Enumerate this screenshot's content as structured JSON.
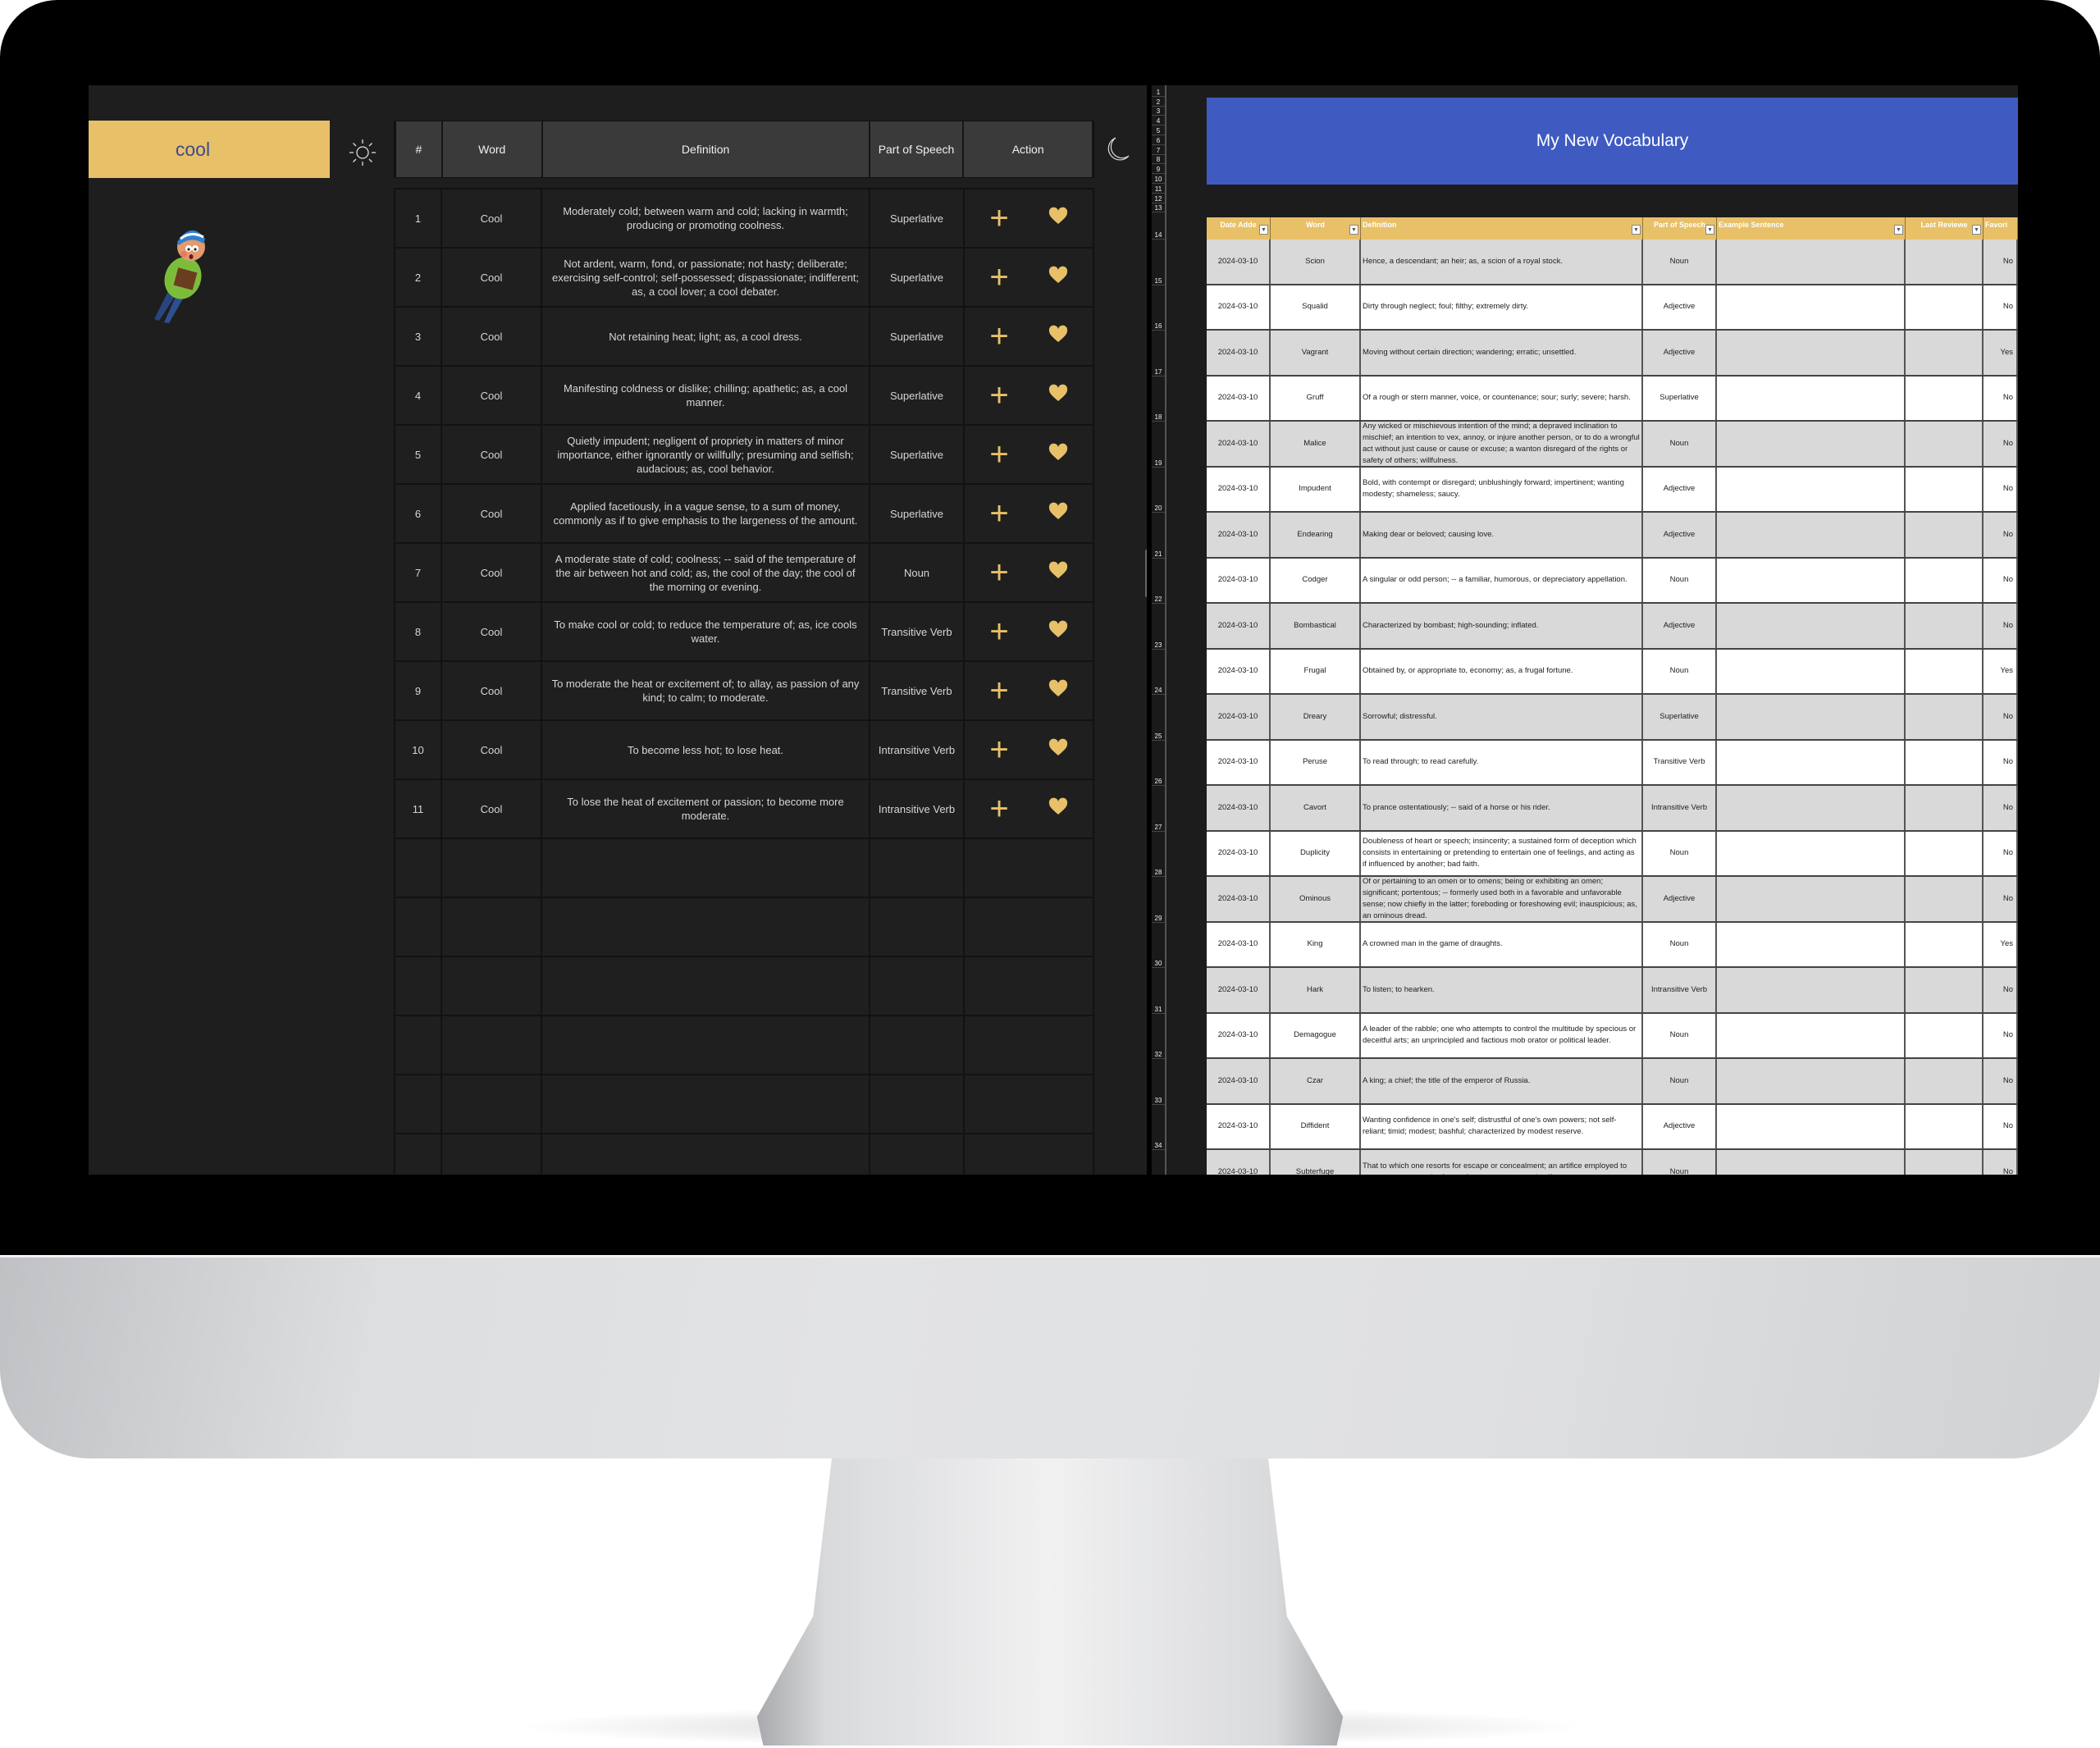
{
  "left_app": {
    "search": {
      "value": "cool"
    },
    "icons": {
      "theme_light": "sun-icon",
      "theme_dark": "moon-icon",
      "add": "plus-icon",
      "favorite": "heart-icon",
      "mascot": "reading-boy-character"
    },
    "colors": {
      "accent": "#e8c068",
      "background": "#1e1e1e",
      "header": "#3a3a3a"
    },
    "table": {
      "headers": [
        "#",
        "Word",
        "Definition",
        "Part of Speech",
        "Action"
      ],
      "rows": [
        {
          "num": "1",
          "word": "Cool",
          "definition": "Moderately cold; between warm and cold; lacking in warmth; producing or promoting coolness.",
          "pos": "Superlative"
        },
        {
          "num": "2",
          "word": "Cool",
          "definition": "Not ardent, warm, fond, or passionate; not hasty; deliberate; exercising self-control; self-possessed; dispassionate; indifferent; as, a cool lover; a cool debater.",
          "pos": "Superlative"
        },
        {
          "num": "3",
          "word": "Cool",
          "definition": "Not retaining heat; light; as, a cool dress.",
          "pos": "Superlative"
        },
        {
          "num": "4",
          "word": "Cool",
          "definition": "Manifesting coldness or dislike; chilling; apathetic; as, a cool manner.",
          "pos": "Superlative"
        },
        {
          "num": "5",
          "word": "Cool",
          "definition": "Quietly impudent; negligent of propriety in matters of minor importance, either ignorantly or willfully; presuming and selfish; audacious; as, cool behavior.",
          "pos": "Superlative"
        },
        {
          "num": "6",
          "word": "Cool",
          "definition": "Applied facetiously, in a vague sense, to a sum of money, commonly as if to give emphasis to the largeness of the amount.",
          "pos": "Superlative"
        },
        {
          "num": "7",
          "word": "Cool",
          "definition": "A moderate state of cold; coolness; -- said of the temperature of the air between hot and cold; as, the cool of the day; the cool of the morning or evening.",
          "pos": "Noun"
        },
        {
          "num": "8",
          "word": "Cool",
          "definition": "To make cool or cold; to reduce the temperature of; as, ice cools water.",
          "pos": "Transitive Verb"
        },
        {
          "num": "9",
          "word": "Cool",
          "definition": "To moderate the heat or excitement of; to allay, as passion of any kind; to calm; to moderate.",
          "pos": "Transitive Verb"
        },
        {
          "num": "10",
          "word": "Cool",
          "definition": "To become less hot; to lose heat.",
          "pos": "Intransitive Verb"
        },
        {
          "num": "11",
          "word": "Cool",
          "definition": "To lose the heat of excitement or passion; to become more moderate.",
          "pos": "Intransitive Verb"
        }
      ]
    }
  },
  "right_app": {
    "title": "My New Vocabulary",
    "colors": {
      "banner": "#3f5bc2",
      "header": "#e8c068",
      "row_alt": "#d9d9d9"
    },
    "row_numbers": [
      "1",
      "2",
      "3",
      "4",
      "5",
      "6",
      "7",
      "8",
      "9",
      "10",
      "11",
      "12",
      "13",
      "14",
      "15",
      "16",
      "17",
      "18",
      "19",
      "20",
      "21",
      "22",
      "23",
      "24",
      "25",
      "26",
      "27",
      "28",
      "29",
      "30",
      "31",
      "32",
      "33",
      "34"
    ],
    "headers": [
      "Date Adde",
      "Word",
      "Definition",
      "Part of Speech",
      "Example Sentence",
      "Last Reviewe",
      "Favori"
    ],
    "rows": [
      {
        "date": "2024-03-10",
        "word": "Scion",
        "definition": "Hence, a descendant; an heir; as, a scion of a royal stock.",
        "pos": "Noun",
        "example": "",
        "reviewed": "",
        "favorite": "No"
      },
      {
        "date": "2024-03-10",
        "word": "Squalid",
        "definition": "Dirty through neglect; foul; filthy; extremely dirty.",
        "pos": "Adjective",
        "example": "",
        "reviewed": "",
        "favorite": "No"
      },
      {
        "date": "2024-03-10",
        "word": "Vagrant",
        "definition": "Moving without certain direction; wandering; erratic; unsettled.",
        "pos": "Adjective",
        "example": "",
        "reviewed": "",
        "favorite": "Yes"
      },
      {
        "date": "2024-03-10",
        "word": "Gruff",
        "definition": "Of a rough or stern manner, voice, or countenance; sour; surly; severe; harsh.",
        "pos": "Superlative",
        "example": "",
        "reviewed": "",
        "favorite": "No"
      },
      {
        "date": "2024-03-10",
        "word": "Malice",
        "definition": "Any wicked or mischievous intention of the mind; a depraved inclination to mischief; an intention to vex, annoy, or injure another person, or to do a wrongful act without just cause or cause or excuse; a wanton disregard of the rights or safety of others; willfulness.",
        "pos": "Noun",
        "example": "",
        "reviewed": "",
        "favorite": "No"
      },
      {
        "date": "2024-03-10",
        "word": "Impudent",
        "definition": "Bold, with contempt or disregard; unblushingly forward; impertinent; wanting modesty; shameless; saucy.",
        "pos": "Adjective",
        "example": "",
        "reviewed": "",
        "favorite": "No"
      },
      {
        "date": "2024-03-10",
        "word": "Endearing",
        "definition": "Making dear or beloved; causing love.",
        "pos": "Adjective",
        "example": "",
        "reviewed": "",
        "favorite": "No"
      },
      {
        "date": "2024-03-10",
        "word": "Codger",
        "definition": "A singular or odd person; -- a familiar, humorous, or depreciatory appellation.",
        "pos": "Noun",
        "example": "",
        "reviewed": "",
        "favorite": "No"
      },
      {
        "date": "2024-03-10",
        "word": "Bombastical",
        "definition": "Characterized by bombast; high-sounding; inflated.",
        "pos": "Adjective",
        "example": "",
        "reviewed": "",
        "favorite": "No"
      },
      {
        "date": "2024-03-10",
        "word": "Frugal",
        "definition": "Obtained by, or appropriate to, economy; as, a frugal fortune.",
        "pos": "Noun",
        "example": "",
        "reviewed": "",
        "favorite": "Yes"
      },
      {
        "date": "2024-03-10",
        "word": "Dreary",
        "definition": "Sorrowful; distressful.",
        "pos": "Superlative",
        "example": "",
        "reviewed": "",
        "favorite": "No"
      },
      {
        "date": "2024-03-10",
        "word": "Peruse",
        "definition": "To read through; to read carefully.",
        "pos": "Transitive Verb",
        "example": "",
        "reviewed": "",
        "favorite": "No"
      },
      {
        "date": "2024-03-10",
        "word": "Cavort",
        "definition": "To prance ostentatiously; -- said of a horse or his rider.",
        "pos": "Intransitive Verb",
        "example": "",
        "reviewed": "",
        "favorite": "No"
      },
      {
        "date": "2024-03-10",
        "word": "Duplicity",
        "definition": "Doubleness of heart or speech; insincerity; a sustained form of deception which consists in entertaining or pretending to entertain one of feelings, and acting as if influenced by another; bad faith.",
        "pos": "Noun",
        "example": "",
        "reviewed": "",
        "favorite": "No"
      },
      {
        "date": "2024-03-10",
        "word": "Ominous",
        "definition": "Of or pertaining to an omen or to omens; being or exhibiting an omen; significant; portentous; -- formerly used both in a favorable and unfavorable sense; now chiefly in the latter; foreboding or foreshowing evil; inauspicious; as, an ominous dread.",
        "pos": "Adjective",
        "example": "",
        "reviewed": "",
        "favorite": "No"
      },
      {
        "date": "2024-03-10",
        "word": "King",
        "definition": "A crowned man in the game of draughts.",
        "pos": "Noun",
        "example": "",
        "reviewed": "",
        "favorite": "Yes"
      },
      {
        "date": "2024-03-10",
        "word": "Hark",
        "definition": "To listen; to hearken.",
        "pos": "Intransitive Verb",
        "example": "",
        "reviewed": "",
        "favorite": "No"
      },
      {
        "date": "2024-03-10",
        "word": "Demagogue",
        "definition": "A leader of the rabble; one who attempts to control the multitude by specious or deceitful arts; an unprincipled and factious mob orator or political leader.",
        "pos": "Noun",
        "example": "",
        "reviewed": "",
        "favorite": "No"
      },
      {
        "date": "2024-03-10",
        "word": "Czar",
        "definition": "A king; a chief; the title of the emperor of Russia.",
        "pos": "Noun",
        "example": "",
        "reviewed": "",
        "favorite": "No"
      },
      {
        "date": "2024-03-10",
        "word": "Diffident",
        "definition": "Wanting confidence in one's self; distrustful of one's own powers; not self-reliant; timid; modest; bashful; characterized by modest reserve.",
        "pos": "Adjective",
        "example": "",
        "reviewed": "",
        "favorite": "No"
      },
      {
        "date": "2024-03-10",
        "word": "Subterfuge",
        "definition": "That to which one resorts for escape or concealment; an artifice employed to escape censure or the force of an argument, or to justify",
        "pos": "Noun",
        "example": "",
        "reviewed": "",
        "favorite": "No"
      }
    ]
  }
}
